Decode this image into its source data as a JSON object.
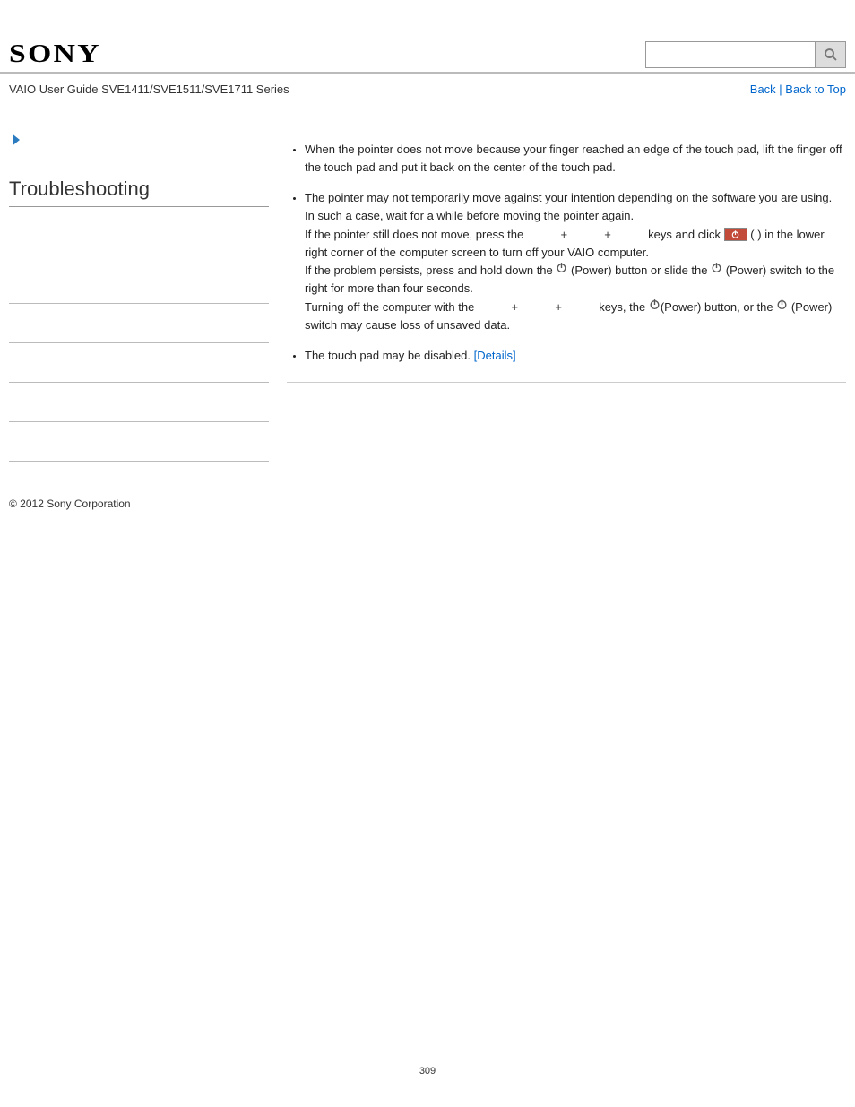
{
  "header": {
    "logo_text": "SONY",
    "search_placeholder": ""
  },
  "breadcrumb": {
    "title": "VAIO User Guide SVE1411/SVE1511/SVE1711 Series",
    "back_label": "Back",
    "separator": " | ",
    "top_label": "Back to Top"
  },
  "sidebar": {
    "title": "Troubleshooting",
    "item_count": 6
  },
  "bullets": {
    "b1": "When the pointer does not move because your finger reached an edge of the touch pad, lift the finger off the touch pad and put it back on the center of the touch pad.",
    "b2": {
      "line1": "The pointer may not temporarily move against your intention depending on the software you are using.",
      "line2": "In such a case, wait for a while before moving the pointer again.",
      "line3a": "If the pointer still does not move, press the ",
      "plus": " + ",
      "line3b": " keys and click ",
      "line3c": " (",
      "line4": ") in the lower right corner of the computer screen to turn off your VAIO computer.",
      "line5a": "If the problem persists, press and hold down the ",
      "power_label": "(Power)",
      "line5b": " button or slide the ",
      "line5c": " switch to the right for more than four seconds.",
      "line6a": "Turning off the computer with the ",
      "line6b": " keys, the ",
      "line6c": " button, or the ",
      "line6d": " switch may cause loss of unsaved data."
    },
    "b3": {
      "text": "The touch pad may be disabled. ",
      "link": "[Details]"
    }
  },
  "footer": {
    "copyright": "© 2012 Sony Corporation",
    "page_number": "309"
  }
}
